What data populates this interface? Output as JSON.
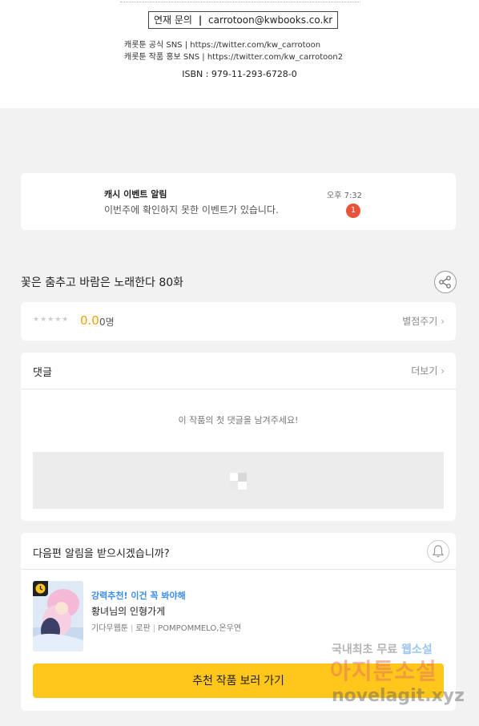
{
  "footer": {
    "contact_label": "연재 문의",
    "contact_email": "carrotoon@kwbooks.co.kr",
    "sns_official": "캐롯툰 공식 SNS | https://twitter.com/kw_carrotoon",
    "sns_promo": "캐롯툰 작품 홍보 SNS | https://twitter.com/kw_carrotoon2",
    "isbn": "ISBN : 979-11-293-6728-0"
  },
  "notice": {
    "title": "캐시 이벤트 알림",
    "body": "이번주에 확인하지 못한 이벤트가 있습니다.",
    "time": "오후 7:32",
    "badge": "1"
  },
  "episode": {
    "title": "꽃은 춤추고 바람은 노래한다 80화",
    "share_icon": "share-icon"
  },
  "rating": {
    "stars": "★★★★★",
    "score": "0.0",
    "count": "0명",
    "rate_button": "별점주기"
  },
  "comments": {
    "heading": "댓글",
    "more": "더보기",
    "empty_text": "이 작품의 첫 댓글을 남겨주세요!"
  },
  "next_episode": {
    "question": "다음편 알림을 받으시겠습니까?",
    "bell_icon": "bell-icon"
  },
  "recommend": {
    "label": "강력추천! 이건 꼭 봐야해",
    "title": "황녀님의 인형가게",
    "meta": [
      "기다무웹툰",
      "로판",
      "POMPOMMELO,온우연"
    ],
    "cta": "추천 작품 보러 가기",
    "accent": "#ffc61c"
  },
  "watermark": {
    "line1_a": "국내최초 무료",
    "line1_b": "웹소설",
    "line2": "아지툰소설",
    "line3": "novelagit.xyz"
  },
  "colors": {
    "background": "#f2f2f2",
    "score": "#f4a100",
    "badge": "#e8533a",
    "link_blue": "#3a8ee6"
  }
}
